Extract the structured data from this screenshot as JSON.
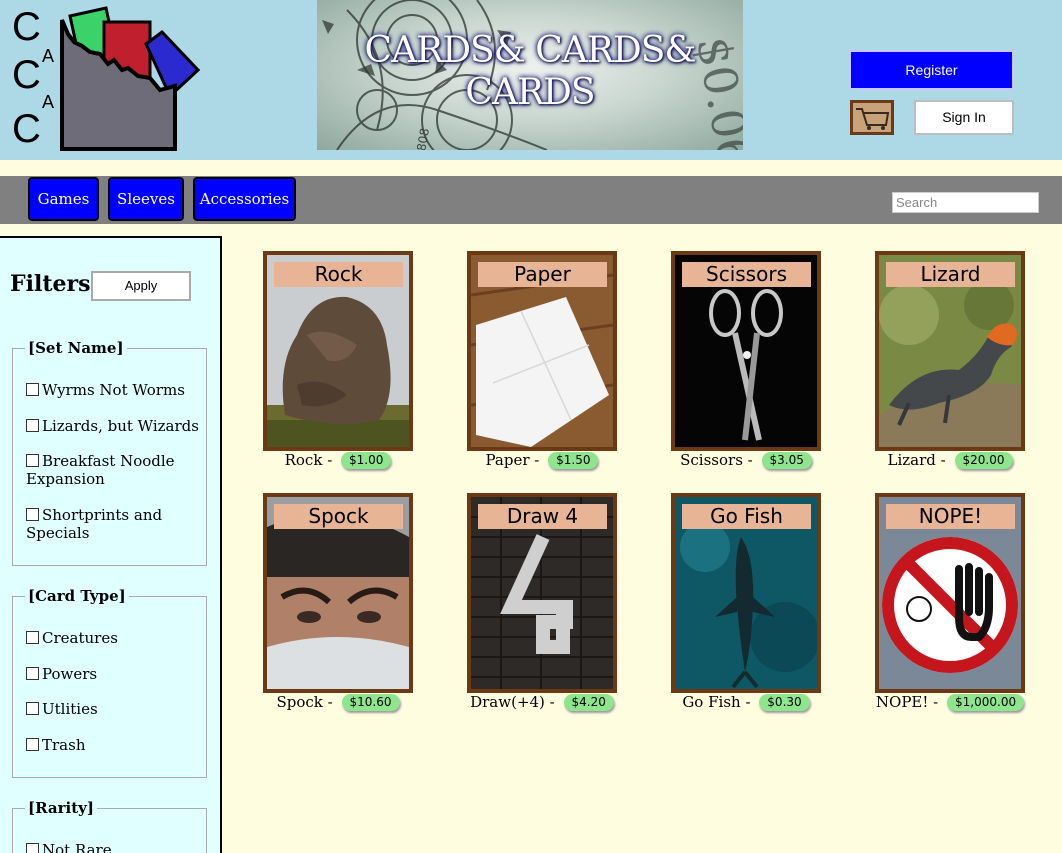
{
  "header": {
    "logo_letters": [
      "C",
      "A",
      "C",
      "A",
      "C"
    ],
    "banner_title": "CARDS& CARDS& CARDS",
    "register_label": "Register",
    "cart_icon": "cart-icon",
    "signin_label": "Sign In"
  },
  "nav": {
    "items": [
      {
        "label": "Games"
      },
      {
        "label": "Sleeves"
      },
      {
        "label": "Accessories"
      }
    ],
    "search_placeholder": "Search"
  },
  "sidebar": {
    "title": "Filters:",
    "apply_label": "Apply",
    "groups": [
      {
        "legend": "[Set Name]",
        "options": [
          "Wyrms Not Worms",
          "Lizards, but Wizards",
          "Breakfast Noodle Expansion",
          "Shortprints and Specials"
        ]
      },
      {
        "legend": "[Card Type]",
        "options": [
          "Creatures",
          "Powers",
          "Utlities",
          "Trash"
        ]
      },
      {
        "legend": "[Rarity]",
        "options": [
          "Not Rare"
        ]
      }
    ]
  },
  "products": [
    {
      "label": "Rock",
      "name": "Rock",
      "price": "$1.00"
    },
    {
      "label": "Paper",
      "name": "Paper",
      "price": "$1.50"
    },
    {
      "label": "Scissors",
      "name": "Scissors",
      "price": "$3.05"
    },
    {
      "label": "Lizard",
      "name": "Lizard",
      "price": "$20.00"
    },
    {
      "label": "Spock",
      "name": "Spock",
      "price": "$10.60"
    },
    {
      "label": "Draw 4",
      "name": "Draw(+4)",
      "price": "$4.20"
    },
    {
      "label": "Go Fish",
      "name": "Go Fish",
      "price": "$0.30"
    },
    {
      "label": "NOPE!",
      "name": "NOPE!",
      "price": "$1,000.00"
    }
  ],
  "colors": {
    "header_bg": "#add8e6",
    "nav_bg": "#808080",
    "nav_button": "#0000ff",
    "sidebar_bg": "#e0ffff",
    "page_bg": "#fffde0",
    "card_border": "#6b3a14",
    "card_label_bg": "#e8b496",
    "price_badge": "#8ee58e"
  }
}
